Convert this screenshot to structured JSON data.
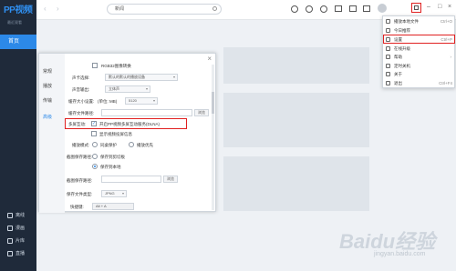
{
  "sidebar": {
    "logo": "PP视频",
    "small_label": "最近观看",
    "home": "首页",
    "bottom_items": [
      {
        "label": "离线"
      },
      {
        "label": "漫画"
      },
      {
        "label": "片库"
      },
      {
        "label": "直播"
      }
    ]
  },
  "topbar": {
    "search_value": "新闻"
  },
  "dialog": {
    "nav": [
      "常规",
      "播放",
      "传输",
      "高级"
    ],
    "top_checkbox": "RGB32图像转换",
    "rows": [
      {
        "label": "声卡选择:",
        "value": "默认的默认的播放设备"
      },
      {
        "label": "声音输出:",
        "value": "立体声"
      },
      {
        "label": "缓存大小设置:",
        "unit": "(单位: MB)",
        "value": "5120"
      },
      {
        "label": "缓存文件路径:",
        "button": "浏览"
      }
    ],
    "highlight_label": "多屏互动:",
    "highlight_option": "开启PP视频多屏互动服务(DLNA)",
    "sub_option": "显示视频投屏信息",
    "sub_option_checked": false,
    "play_mode_label": "播放模式:",
    "play_mode_options": [
      "同桌保护",
      "播放优先"
    ],
    "screenshot_label": "截图保存路径:",
    "screenshot_options": [
      "保存到剪切板",
      "保存到本地"
    ],
    "screenshot_path_label": "截图保存路径:",
    "screenshot_path_button": "浏览",
    "screenshot_type_label": "保存文件类型:",
    "screenshot_type_value": "JPNG",
    "hotkey_label": "快捷键:",
    "hotkey_value": "Alt + A"
  },
  "dropdown": {
    "items": [
      {
        "label": "播放本地文件",
        "key": "Ctrl+O"
      },
      {
        "label": "今日推荐",
        "key": ""
      },
      {
        "label": "设置",
        "key": "Ctrl+P"
      },
      {
        "label": "在线升级",
        "key": ""
      },
      {
        "label": "帮助",
        "key": "",
        "arrow": "›"
      },
      {
        "label": "定时关机",
        "key": ""
      },
      {
        "label": "关于",
        "key": ""
      },
      {
        "label": "退出",
        "key": "Ctrl+F4"
      }
    ]
  },
  "watermark": {
    "text": "Baidu经验",
    "sub": "jingyan.baidu.com"
  },
  "colors": {
    "accent": "#2c89e8",
    "highlight": "#e02020",
    "sidebar_bg": "#1f2a3a"
  }
}
